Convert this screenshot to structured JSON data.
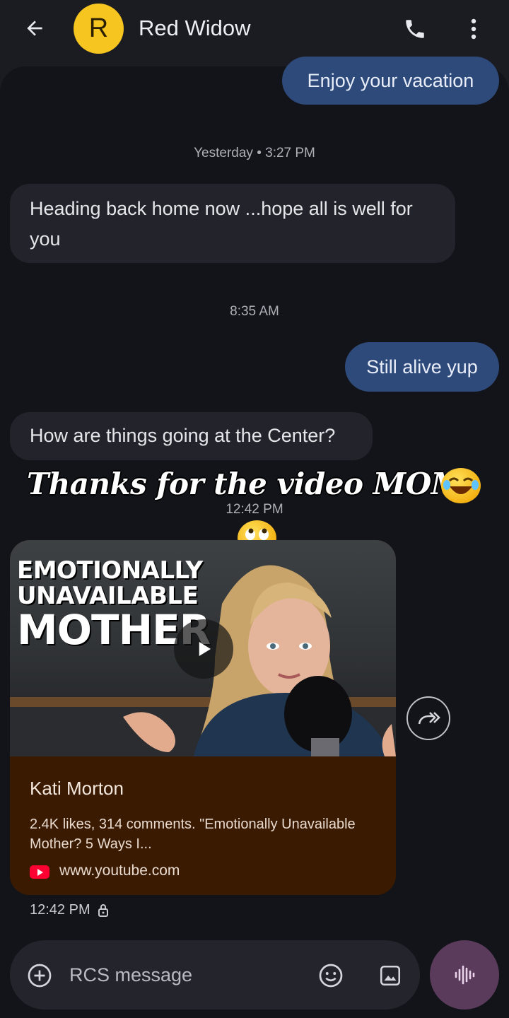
{
  "header": {
    "contact_initial": "R",
    "contact_name": "Red Widow",
    "avatar_color": "#f7c51f",
    "icons": [
      "back-arrow-icon",
      "phone-icon",
      "more-vert-icon"
    ]
  },
  "messages": [
    {
      "type": "outgoing",
      "text": "Enjoy your vacation"
    },
    {
      "type": "timestamp",
      "text": "Yesterday • 3:27 PM"
    },
    {
      "type": "incoming",
      "text": "Heading back home now ...hope all is well for you"
    },
    {
      "type": "timestamp",
      "text": "8:35 AM"
    },
    {
      "type": "outgoing",
      "text": "Still alive yup"
    },
    {
      "type": "incoming",
      "text": "How are things going at the Center?"
    },
    {
      "type": "sticker",
      "text": "Thanks for the video MOM"
    },
    {
      "type": "timestamp",
      "text": "12:42 PM"
    }
  ],
  "link_preview": {
    "thumbnail_title": [
      "EMOTIONALLY",
      "UNAVAILABLE",
      "MOTHER"
    ],
    "title": "Kati Morton",
    "description": "2.4K likes, 314 comments. \"Emotionally Unavailable Mother? 5 Ways I...",
    "domain": "www.youtube.com",
    "card_color": "#3a1a00"
  },
  "meta": {
    "time": "12:42 PM"
  },
  "composer": {
    "placeholder": "RCS message"
  },
  "colors": {
    "outgoing_bubble": "#2e4a7b",
    "incoming_bubble": "#23242b",
    "background": "#131419",
    "voice_button": "#5a3b5b"
  }
}
